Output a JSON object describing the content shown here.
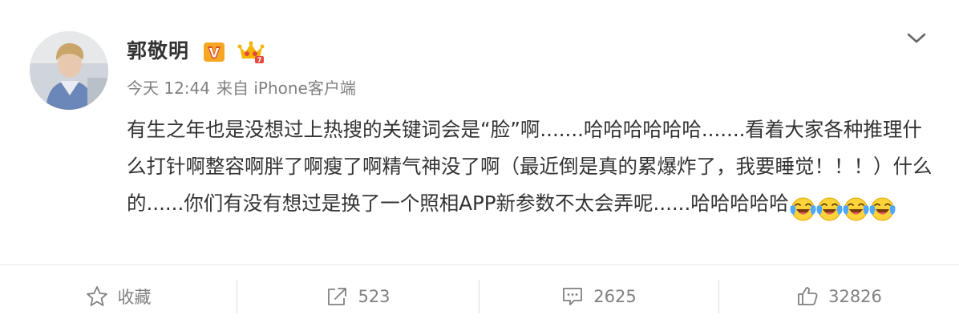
{
  "post": {
    "user_name": "郭敬明",
    "time": "今天 12:44",
    "source": "来自 iPhone客户端",
    "text": "有生之年也是没想过上热搜的关键词会是“脸”啊.......哈哈哈哈哈哈.......看着大家各种推理什么打针啊整容啊胖了啊瘦了啊精气神没了啊（最近倒是真的累爆炸了，我要睡觉！！！）什么的......你们有没有想过是换了一个照相APP新参数不太会弄呢......哈哈哈哈哈",
    "emoji_count": 4,
    "emoji_icon": "laugh-cry-icon"
  },
  "actions": {
    "favorite_label": "收藏",
    "repost_count": "523",
    "comment_count": "2625",
    "like_count": "32826"
  },
  "colors": {
    "text": "#333333",
    "meta": "#808080",
    "verified_badge": "#f5a623",
    "divider": "#e9e9e9"
  }
}
